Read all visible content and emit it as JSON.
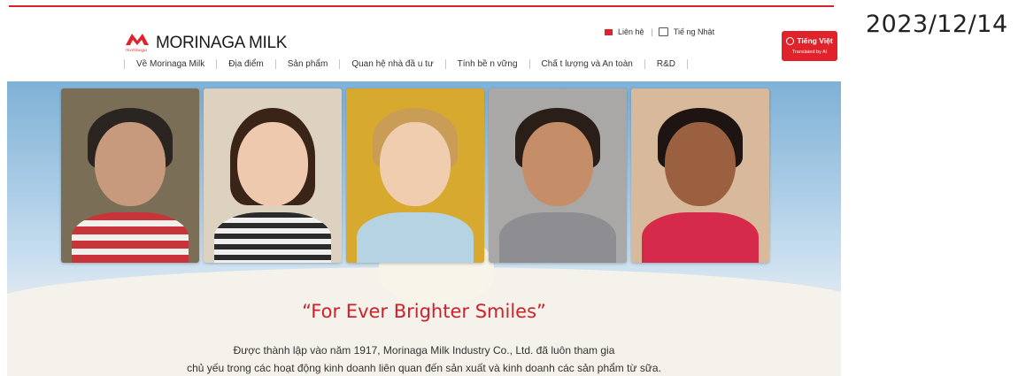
{
  "date_stamp": "2023/12/14",
  "brand": {
    "logo_script": "morinaga",
    "name": "MORINAGA MILK",
    "color": "#e0232b"
  },
  "utility": {
    "contact": "Liên hệ",
    "language_link": "Tiế ng Nhật"
  },
  "language_button": {
    "label": "Tiếng Việt",
    "sublabel": "Translated by AI"
  },
  "nav": [
    {
      "label": "Về Morinaga Milk"
    },
    {
      "label": "Địa điểm"
    },
    {
      "label": "Sản phẩm"
    },
    {
      "label": "Quan hệ nhà đầ u tư"
    },
    {
      "label": "Tính bề n vững"
    },
    {
      "label": "Chấ t lượng và An toàn"
    },
    {
      "label": "R&D"
    }
  ],
  "hero": {
    "slogan": "“For Ever Brighter Smiles”",
    "desc_line1": "Được thành lập vào năm 1917, Morinaga Milk Industry Co., Ltd. đã luôn tham gia",
    "desc_line2": "chủ yếu trong các hoạt động kinh doanh liên quan đến sản xuất và kinh doanh các sản phẩm từ sữa."
  },
  "icons": [
    "morinaga-logo-icon",
    "mail-icon",
    "window-icon",
    "globe-icon"
  ]
}
